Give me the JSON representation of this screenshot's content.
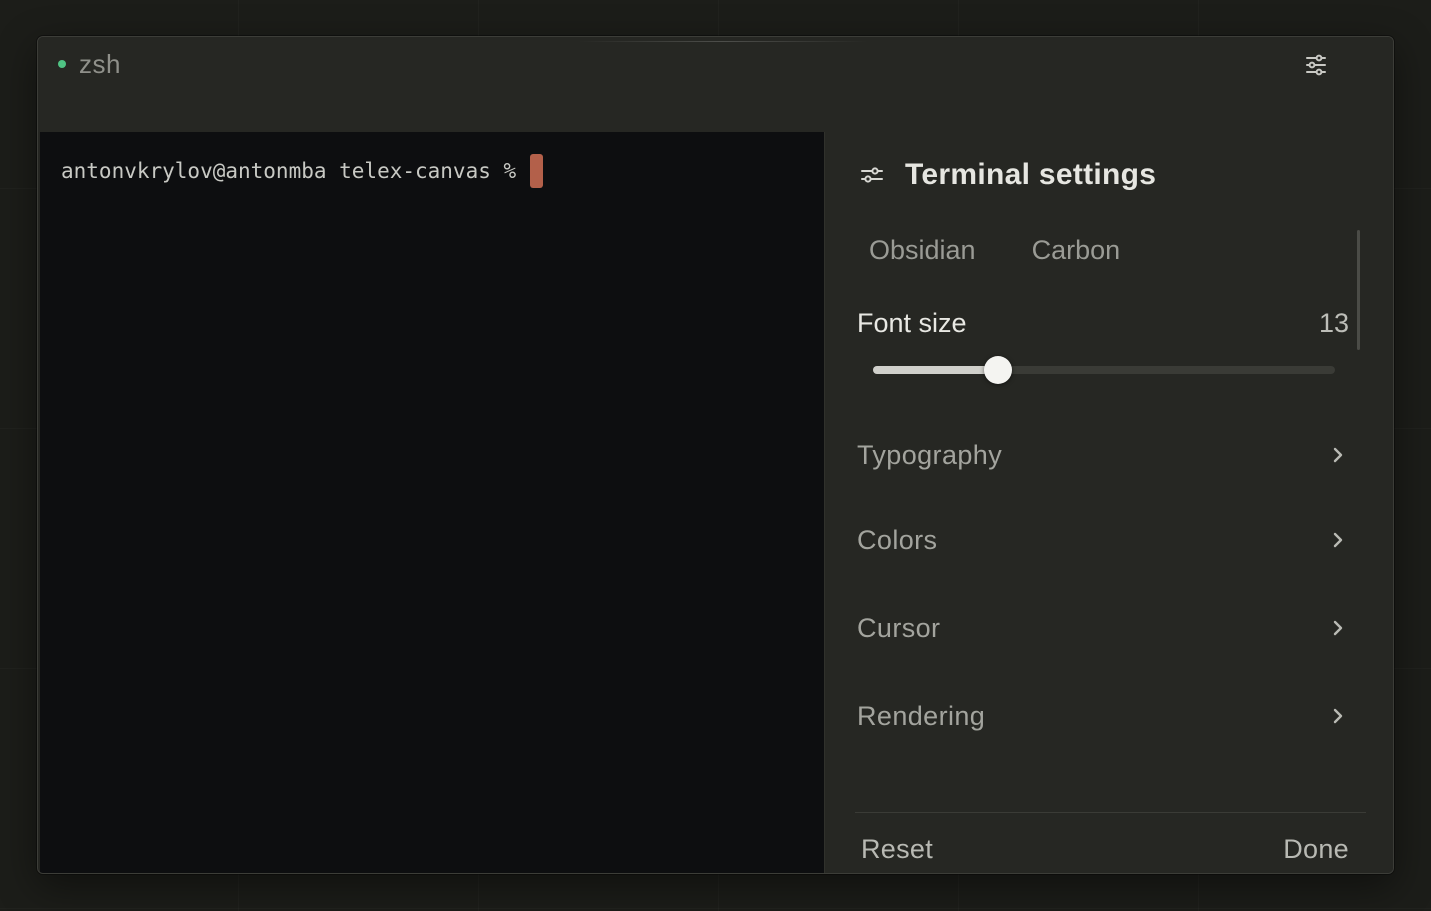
{
  "window": {
    "status_color": "#4fc383",
    "session_name": "zsh",
    "settings_icon": "sliders-icon"
  },
  "terminal": {
    "prompt": "antonvkrylov@antonmba telex-canvas %",
    "cursor_color": "#b3604a"
  },
  "settings_panel": {
    "title": "Terminal settings",
    "title_icon": "sliders-icon",
    "themes": [
      {
        "label": "Obsidian"
      },
      {
        "label": "Carbon"
      }
    ],
    "font_size": {
      "label": "Font size",
      "value": "13",
      "slider_fraction": 0.27
    },
    "sections": [
      {
        "label": "Typography",
        "icon": "chevron-right-icon"
      },
      {
        "label": "Colors",
        "icon": "chevron-right-icon"
      },
      {
        "label": "Cursor",
        "icon": "chevron-right-icon"
      },
      {
        "label": "Rendering",
        "icon": "chevron-right-icon"
      }
    ],
    "footer": {
      "reset_label": "Reset",
      "done_label": "Done"
    }
  }
}
